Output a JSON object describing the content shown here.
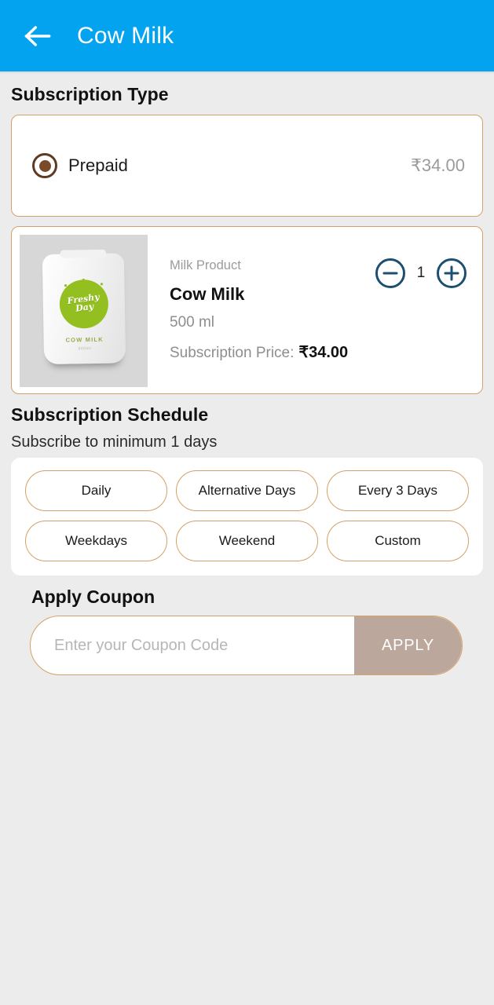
{
  "header": {
    "back_icon": "arrow-left-icon",
    "title": "Cow Milk",
    "background_color": "#03A3EF"
  },
  "subscription_type": {
    "section_title": "Subscription Type",
    "options": [
      {
        "label": "Prepaid",
        "price": "₹34.00",
        "selected": true
      }
    ],
    "radio_color": "#5f3a22"
  },
  "product": {
    "category": "Milk Product",
    "name": "Cow Milk",
    "size": "500 ml",
    "price_label": "Subscription Price:",
    "price_value": "₹34.00",
    "quantity": "1",
    "decrease_icon": "minus-circle-icon",
    "increase_icon": "plus-circle-icon",
    "stepper_color": "#1b4f72",
    "image": {
      "brand_script": "Freshy\nDay",
      "pack_label": "COW MILK",
      "pack_sub": "500ml",
      "accent_color": "#93c020"
    }
  },
  "schedule": {
    "section_title": "Subscription Schedule",
    "minimum_note": "Subscribe to minimum 1 days",
    "options": [
      {
        "label": "Daily"
      },
      {
        "label": "Alternative Days"
      },
      {
        "label": "Every 3 Days"
      },
      {
        "label": "Weekdays"
      },
      {
        "label": "Weekend"
      },
      {
        "label": "Custom"
      }
    ]
  },
  "coupon": {
    "section_title": "Apply Coupon",
    "placeholder": "Enter your Coupon Code",
    "value": "",
    "apply_label": "APPLY",
    "apply_color": "#bca79c"
  },
  "theme": {
    "page_background": "#ececec",
    "card_border": "#d6a066"
  }
}
